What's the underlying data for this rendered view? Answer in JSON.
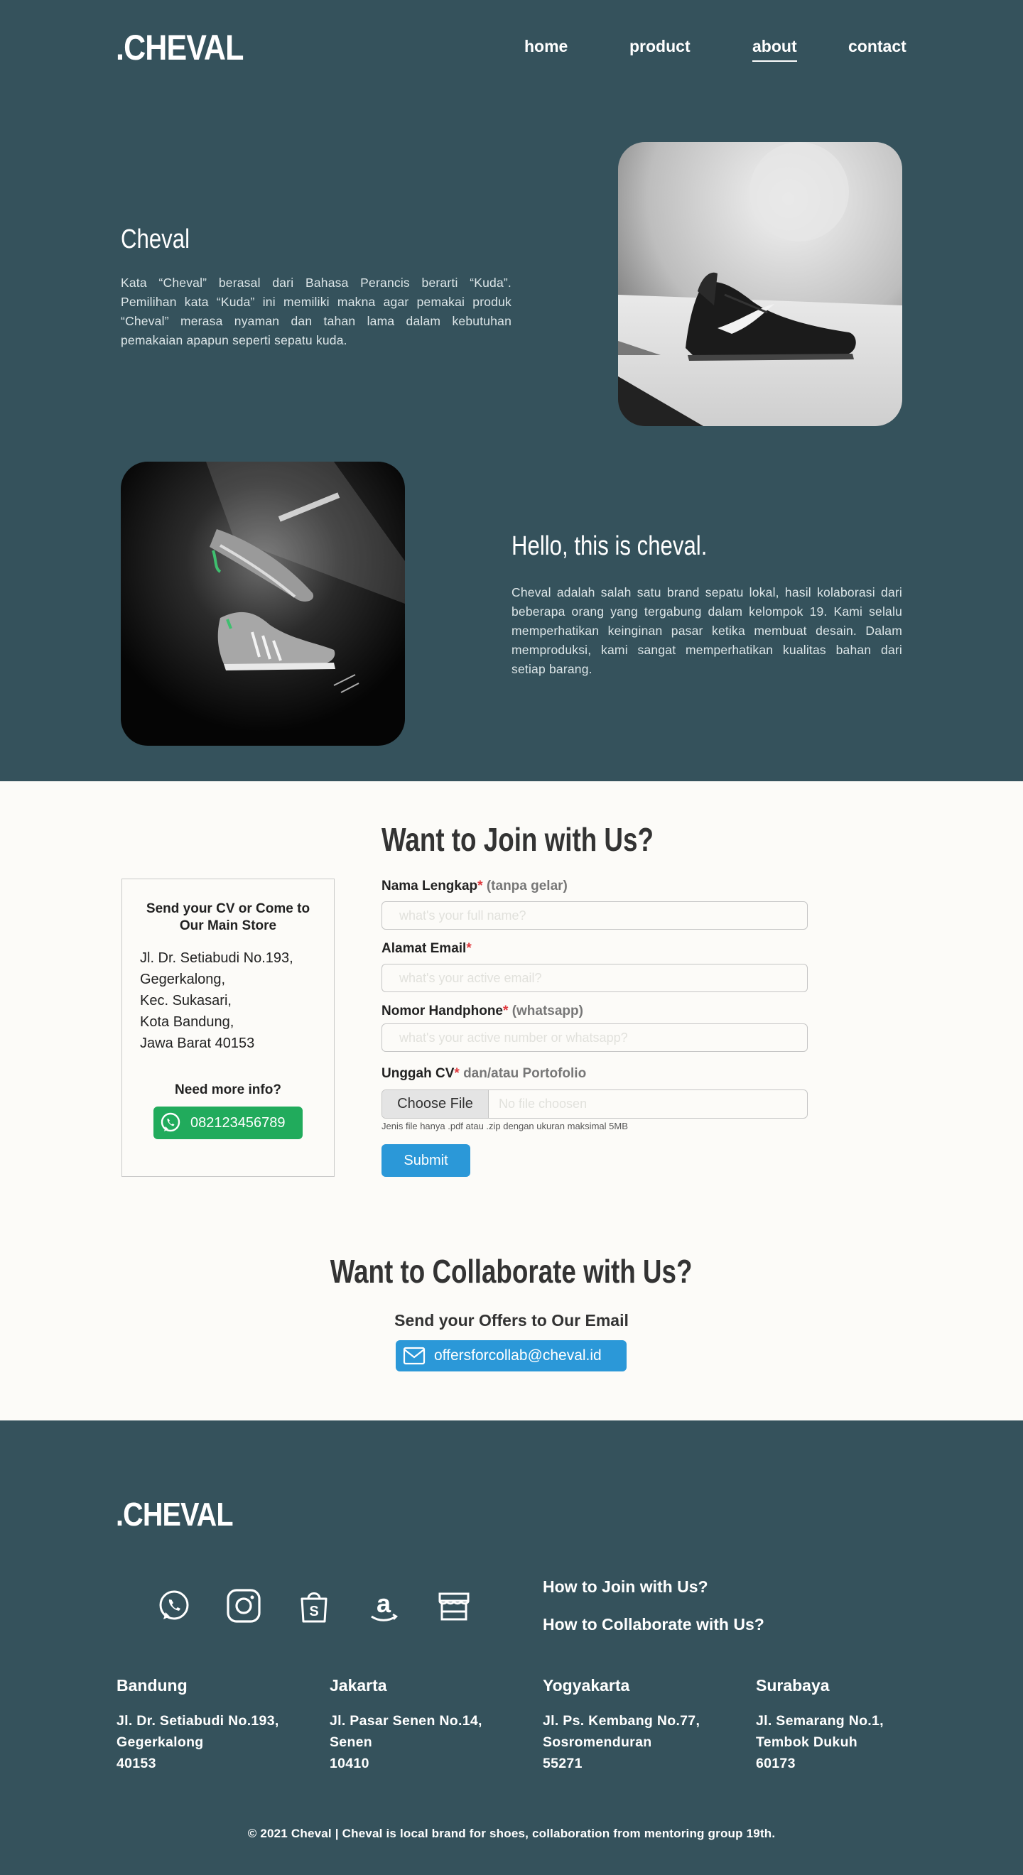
{
  "brand": ".CHEVAL",
  "nav": {
    "home": "home",
    "product": "product",
    "about": "about",
    "contact": "contact"
  },
  "about1": {
    "title": "Cheval",
    "text": "Kata “Cheval” berasal dari Bahasa Perancis berarti “Kuda”. Pemilihan kata “Kuda” ini memiliki makna agar pemakai produk “Cheval” merasa nyaman dan tahan lama dalam kebutuhan pemakaian apapun seperti sepatu kuda."
  },
  "about2": {
    "title": "Hello, this is cheval.",
    "text": "Cheval adalah salah satu brand sepatu lokal, hasil kolaborasi dari beberapa orang yang tergabung dalam kelompok 19. Kami selalu memperhatikan keinginan pasar ketika membuat desain. Dalam memproduksi, kami sangat memperhatikan kualitas bahan  dari setiap barang."
  },
  "join": {
    "title": "Want to Join with Us?",
    "card": {
      "title": "Send your CV or Come to Our Main Store",
      "address": [
        "Jl. Dr. Setiabudi No.193,",
        "Gegerkalong,",
        "Kec. Sukasari,",
        "Kota Bandung,",
        "Jawa Barat 40153"
      ],
      "more": "Need more info?",
      "phone": "082123456789"
    },
    "form": {
      "name_label": "Nama Lengkap",
      "name_hint": "(tanpa gelar)",
      "name_placeholder": "what's your full name?",
      "email_label": "Alamat Email",
      "email_placeholder": "what's your active email?",
      "phone_label": "Nomor Handphone",
      "phone_hint": "(whatsapp)",
      "phone_placeholder": "what's your active number or whatsapp?",
      "cv_label": "Unggah CV",
      "cv_hint": "dan/atau Portofolio",
      "choose_file": "Choose File",
      "no_file": "No file choosen",
      "file_note": "Jenis file hanya .pdf atau .zip dengan ukuran maksimal 5MB",
      "submit": "Submit",
      "required_mark": "*"
    }
  },
  "collab": {
    "title": "Want to Collaborate with Us?",
    "subtitle": "Send your Offers to Our Email",
    "email": "offersforcollab@cheval.id"
  },
  "footer": {
    "brand": ".CHEVAL",
    "icons": [
      "whatsapp-icon",
      "instagram-icon",
      "shopee-icon",
      "amazon-icon",
      "store-icon"
    ],
    "links": [
      "How to Join with Us?",
      "How to Collaborate with Us?"
    ],
    "cities": [
      {
        "name": "Bandung",
        "lines": [
          "Jl. Dr. Setiabudi No.193,",
          "Gegerkalong",
          "40153"
        ]
      },
      {
        "name": "Jakarta",
        "lines": [
          "Jl. Pasar Senen No.14,",
          "Senen",
          "10410"
        ]
      },
      {
        "name": "Yogyakarta",
        "lines": [
          "Jl. Ps. Kembang No.77,",
          "Sosromenduran",
          "55271"
        ]
      },
      {
        "name": "Surabaya",
        "lines": [
          "Jl. Semarang No.1,",
          "Tembok Dukuh",
          "60173"
        ]
      }
    ],
    "copyright": "© 2021 Cheval | Cheval is local brand for shoes, collaboration from mentoring group 19th."
  },
  "colors": {
    "dark": "#35525c",
    "light": "#fcfbf8",
    "whatsapp": "#21ab5c",
    "blue": "#2b98d8",
    "required": "#e0393e"
  }
}
